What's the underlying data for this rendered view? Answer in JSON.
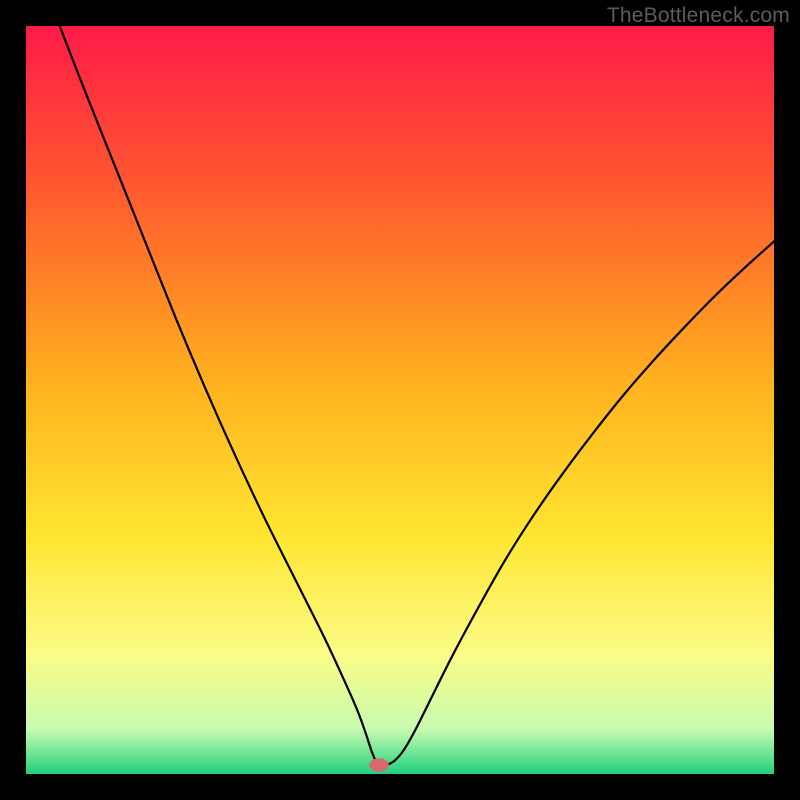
{
  "watermark": "TheBottleneck.com",
  "colors": {
    "gradient_stops": [
      {
        "offset": "0%",
        "color": "#ff1a49"
      },
      {
        "offset": "22%",
        "color": "#ff5a2e"
      },
      {
        "offset": "48%",
        "color": "#ffb21e"
      },
      {
        "offset": "68%",
        "color": "#ffe531"
      },
      {
        "offset": "84%",
        "color": "#fbfc86"
      },
      {
        "offset": "94%",
        "color": "#c9fbb0"
      },
      {
        "offset": "100%",
        "color": "#20d07e"
      }
    ],
    "curve": "#000000",
    "marker": "#d86a6f"
  },
  "chart_data": {
    "type": "line",
    "title": "",
    "xlabel": "",
    "ylabel": "",
    "xlim": [
      0,
      100
    ],
    "ylim": [
      0,
      100
    ],
    "note": "Axes are unlabeled; values are percentages of the plot area. y runs top(0)→bottom(100). Curve estimated from pixels.",
    "marker": {
      "x": 47.2,
      "y": 98.8
    },
    "series": [
      {
        "name": "bottleneck-curve",
        "x": [
          4.5,
          8,
          12,
          16,
          20,
          24,
          28,
          32,
          36,
          40,
          43,
          44.5,
          45.5,
          46.3,
          47.2,
          48.2,
          49.3,
          50.5,
          52,
          54,
          57,
          60,
          64,
          68,
          72,
          76,
          80,
          84,
          88,
          92,
          96,
          100
        ],
        "y": [
          0,
          9,
          19,
          29,
          39,
          48.5,
          57.5,
          66,
          74,
          82,
          88.5,
          92,
          94.8,
          97.2,
          99.0,
          98.8,
          98.2,
          96.8,
          94.2,
          90.2,
          84.2,
          78.6,
          71.5,
          65.2,
          59.5,
          54.2,
          49.2,
          44.6,
          40.3,
          36.2,
          32.4,
          28.8
        ]
      }
    ]
  }
}
